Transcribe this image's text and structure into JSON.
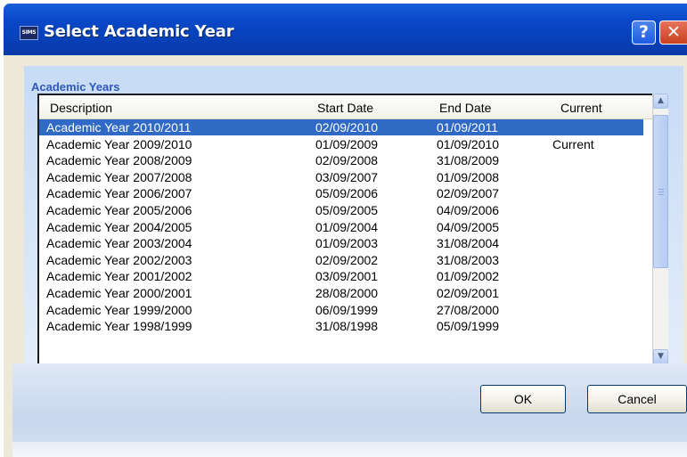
{
  "window": {
    "title": "Select Academic Year",
    "app_logo_text": "SIMS",
    "help_glyph": "?",
    "close_glyph": "✕"
  },
  "group": {
    "label": "Academic Years"
  },
  "table": {
    "columns": [
      "Description",
      "Start Date",
      "End Date",
      "Current"
    ],
    "rows": [
      [
        "Academic Year 2010/2011",
        "02/09/2010",
        "01/09/2011",
        ""
      ],
      [
        "Academic Year 2009/2010",
        "01/09/2009",
        "01/09/2010",
        "Current"
      ],
      [
        "Academic Year 2008/2009",
        "02/09/2008",
        "31/08/2009",
        ""
      ],
      [
        "Academic Year 2007/2008",
        "03/09/2007",
        "01/09/2008",
        ""
      ],
      [
        "Academic Year 2006/2007",
        "05/09/2006",
        "02/09/2007",
        ""
      ],
      [
        "Academic Year 2005/2006",
        "05/09/2005",
        "04/09/2006",
        ""
      ],
      [
        "Academic Year 2004/2005",
        "01/09/2004",
        "04/09/2005",
        ""
      ],
      [
        "Academic Year 2003/2004",
        "01/09/2003",
        "31/08/2004",
        ""
      ],
      [
        "Academic Year 2002/2003",
        "02/09/2002",
        "31/08/2003",
        ""
      ],
      [
        "Academic Year 2001/2002",
        "03/09/2001",
        "01/09/2002",
        ""
      ],
      [
        "Academic Year 2000/2001",
        "28/08/2000",
        "02/09/2001",
        ""
      ],
      [
        "Academic Year 1999/2000",
        "06/09/1999",
        "27/08/2000",
        ""
      ],
      [
        "Academic Year 1998/1999",
        "31/08/1998",
        "05/09/1999",
        ""
      ]
    ],
    "selected_row": 0
  },
  "scrollbar": {
    "up_icon": "▲",
    "down_icon": "▼"
  },
  "buttons": {
    "ok": "OK",
    "cancel": "Cancel"
  },
  "colors": {
    "title_bar": "#0a49c9",
    "selection": "#316ac5",
    "group_label": "#2f57b8",
    "close_button": "#c8421f"
  }
}
